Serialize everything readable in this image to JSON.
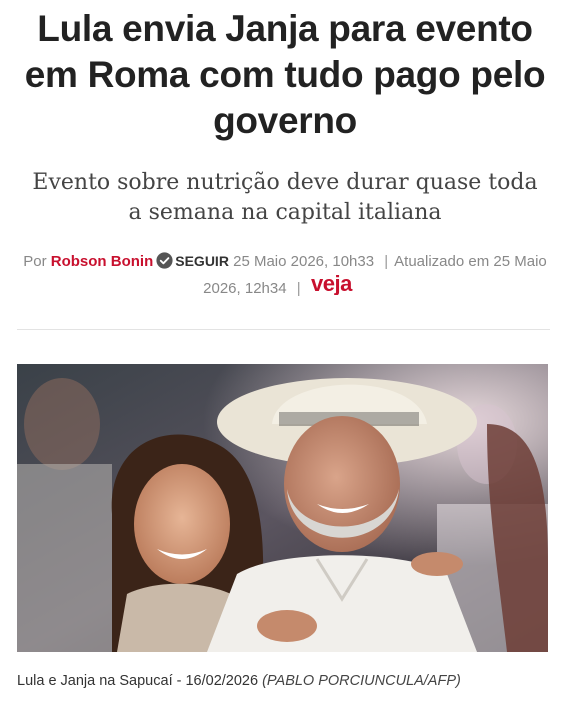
{
  "article": {
    "headline": "Lula envia Janja para evento em Roma com tudo pago pelo governo",
    "subtitle": "Evento sobre nutrição deve durar quase toda a semana na capital italiana",
    "byline": {
      "prefix": "Por",
      "author": "Robson Bonin",
      "follow_label": "SEGUIR",
      "published": "25 Maio 2026, 10h33",
      "updated_prefix": "Atualizado em",
      "updated": "25 Maio 2026, 12h34",
      "brand": "veja"
    },
    "photo": {
      "caption": "Lula e Janja na Sapucaí - 16/02/2026",
      "credit": "(PABLO PORCIUNCULA/AFP)"
    }
  },
  "colors": {
    "brand_red": "#c8102e",
    "text_dark": "#222222",
    "text_muted": "#888888"
  },
  "icons": {
    "verified": "verified-check-icon",
    "brand_logo": "veja-logo"
  }
}
